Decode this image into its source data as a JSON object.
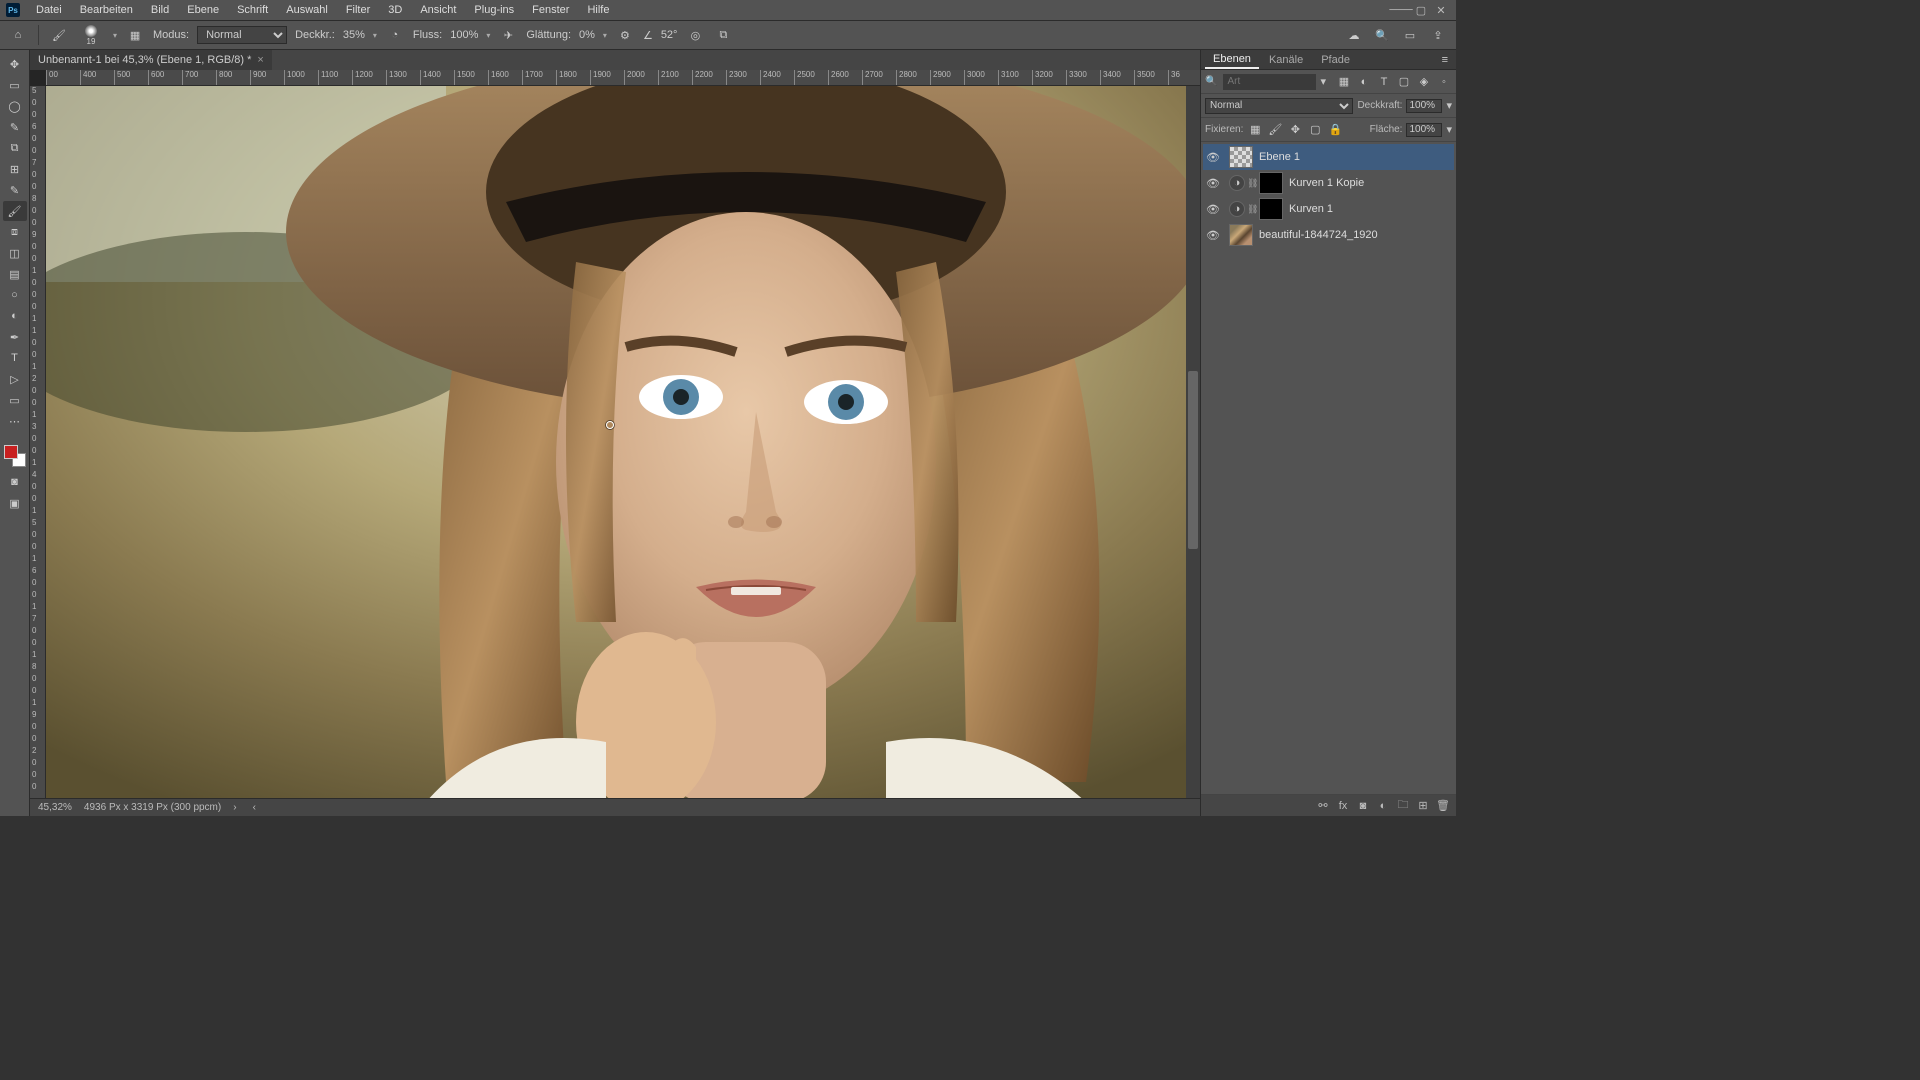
{
  "menu": {
    "items": [
      "Datei",
      "Bearbeiten",
      "Bild",
      "Ebene",
      "Schrift",
      "Auswahl",
      "Filter",
      "3D",
      "Ansicht",
      "Plug-ins",
      "Fenster",
      "Hilfe"
    ]
  },
  "options": {
    "brush_size": "19",
    "mode_label": "Modus:",
    "mode_value": "Normal",
    "opacity_label": "Deckkr.:",
    "opacity_value": "35%",
    "flow_label": "Fluss:",
    "flow_value": "100%",
    "smoothing_label": "Glättung:",
    "smoothing_value": "0%",
    "angle_icon": "∠",
    "angle_value": "52°"
  },
  "document": {
    "tab_title": "Unbenannt-1 bei 45,3% (Ebene 1, RGB/8) *"
  },
  "ruler_h": [
    "00",
    "400",
    "500",
    "600",
    "700",
    "800",
    "900",
    "1000",
    "1100",
    "1200",
    "1300",
    "1400",
    "1500",
    "1600",
    "1700",
    "1800",
    "1900",
    "2000",
    "2100",
    "2200",
    "2300",
    "2400",
    "2500",
    "2600",
    "2700",
    "2800",
    "2900",
    "3000",
    "3100",
    "3200",
    "3300",
    "3400",
    "3500",
    "36"
  ],
  "ruler_v_labels": [
    "5",
    "0",
    "0",
    "6",
    "0",
    "0",
    "7",
    "0",
    "0",
    "8",
    "0",
    "0",
    "9",
    "0",
    "0",
    "1",
    "0",
    "0",
    "0",
    "1",
    "1",
    "0",
    "0",
    "1",
    "2",
    "0",
    "0",
    "1",
    "3",
    "0",
    "0",
    "1",
    "4",
    "0",
    "0",
    "1",
    "5",
    "0",
    "0",
    "1",
    "6",
    "0",
    "0",
    "1",
    "7",
    "0",
    "0",
    "1",
    "8",
    "0",
    "0",
    "1",
    "9",
    "0",
    "0",
    "2",
    "0",
    "0",
    "0"
  ],
  "status": {
    "zoom": "45,32%",
    "doc_info": "4936 Px x 3319 Px (300 ppcm)"
  },
  "panels": {
    "tabs": [
      "Ebenen",
      "Kanäle",
      "Pfade"
    ],
    "search_placeholder": "Art",
    "blend_mode": "Normal",
    "opacity_label": "Deckkraft:",
    "opacity_value": "100%",
    "lock_label": "Fixieren:",
    "fill_label": "Fläche:",
    "fill_value": "100%",
    "layers": [
      {
        "name": "Ebene 1",
        "type": "checker",
        "active": true
      },
      {
        "name": "Kurven 1 Kopie",
        "type": "adjustment"
      },
      {
        "name": "Kurven 1",
        "type": "adjustment"
      },
      {
        "name": "beautiful-1844724_1920",
        "type": "photo"
      }
    ]
  }
}
